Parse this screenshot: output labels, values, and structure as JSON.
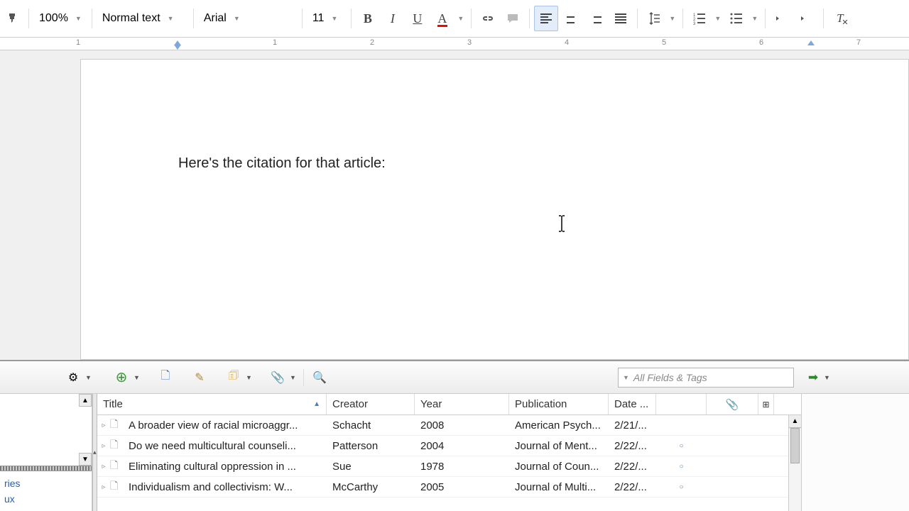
{
  "toolbar": {
    "zoom": "100%",
    "style": "Normal text",
    "font": "Arial",
    "size": "11"
  },
  "ruler": {
    "numbers": [
      "1",
      "1",
      "2",
      "3",
      "4",
      "5",
      "6",
      "7"
    ]
  },
  "document": {
    "text": "Here's the citation for that article:"
  },
  "zotero": {
    "search_placeholder": "All Fields & Tags",
    "left_items": [
      "ries",
      "ux"
    ],
    "columns": {
      "title": "Title",
      "creator": "Creator",
      "year": "Year",
      "publication": "Publication",
      "date": "Date ..."
    },
    "rows": [
      {
        "title": "A broader view of racial microaggr...",
        "creator": "Schacht",
        "year": "2008",
        "pub": "American Psych...",
        "date": "2/21/...",
        "tag": ""
      },
      {
        "title": "Do we need multicultural counseli...",
        "creator": "Patterson",
        "year": "2004",
        "pub": "Journal of Ment...",
        "date": "2/22/...",
        "tag": "○"
      },
      {
        "title": "Eliminating cultural oppression in ...",
        "creator": "Sue",
        "year": "1978",
        "pub": "Journal of Coun...",
        "date": "2/22/...",
        "tag": "○"
      },
      {
        "title": "Individualism and collectivism: W...",
        "creator": "McCarthy",
        "year": "2005",
        "pub": "Journal of Multi...",
        "date": "2/22/...",
        "tag": "○"
      }
    ]
  }
}
